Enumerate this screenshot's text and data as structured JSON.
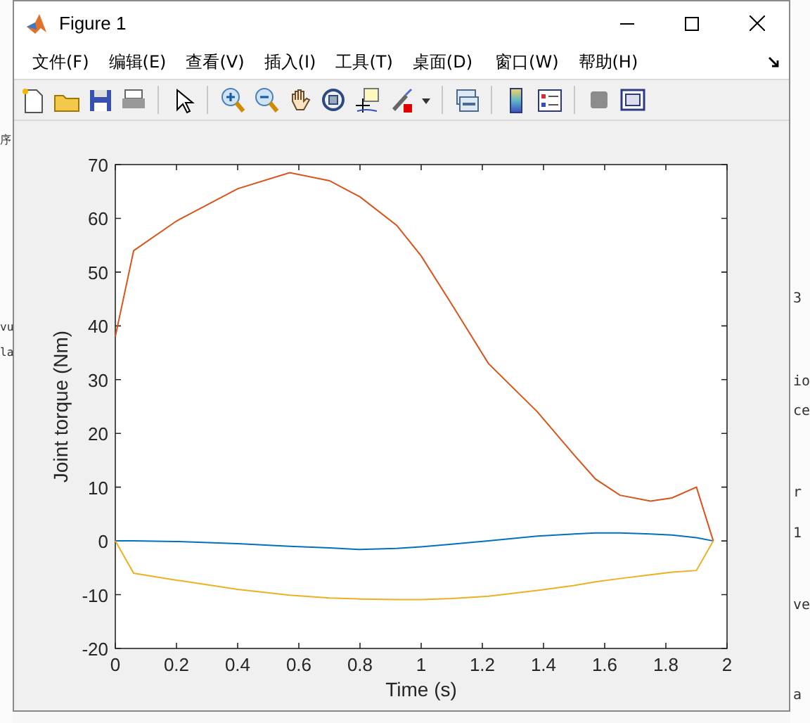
{
  "background": {
    "left_fragments": [
      "序",
      "vu",
      "la"
    ],
    "right_fragments": [
      "3",
      "io",
      "ce",
      "r",
      "1",
      "ve",
      "a"
    ]
  },
  "window": {
    "title": "Figure 1"
  },
  "menu": [
    "文件(F)",
    "编辑(E)",
    "查看(V)",
    "插入(I)",
    "工具(T)",
    "桌面(D)",
    "窗口(W)",
    "帮助(H)"
  ],
  "figure": {
    "chart_data": {
      "type": "line",
      "xlabel": "Time (s)",
      "ylabel": "Joint torque (Nm)",
      "xlim": [
        0,
        2
      ],
      "ylim": [
        -20,
        70
      ],
      "xticks": [
        0,
        0.2,
        0.4,
        0.6,
        0.8,
        1,
        1.2,
        1.4,
        1.6,
        1.8,
        2
      ],
      "yticks": [
        -20,
        -10,
        0,
        10,
        20,
        30,
        40,
        50,
        60,
        70
      ],
      "x": [
        0,
        0.06,
        0.2,
        0.4,
        0.57,
        0.7,
        0.8,
        0.92,
        1.0,
        1.1,
        1.22,
        1.38,
        1.5,
        1.57,
        1.65,
        1.75,
        1.82,
        1.9,
        1.955
      ],
      "series": [
        {
          "color": "#0072bd",
          "values": [
            0,
            0,
            -0.1,
            -0.5,
            -1,
            -1.3,
            -1.6,
            -1.4,
            -1.1,
            -0.6,
            0,
            0.9,
            1.3,
            1.5,
            1.5,
            1.3,
            1.1,
            0.6,
            0
          ]
        },
        {
          "color": "#d95319",
          "values": [
            38,
            54,
            59.5,
            65.5,
            68.5,
            67,
            64,
            58.7,
            53,
            44,
            33,
            24,
            16,
            11.5,
            8.5,
            7.4,
            8,
            10,
            0
          ]
        },
        {
          "color": "#edb120",
          "values": [
            0,
            -6,
            -7.3,
            -9,
            -10.1,
            -10.6,
            -10.8,
            -10.9,
            -10.9,
            -10.7,
            -10.3,
            -9.2,
            -8.3,
            -7.6,
            -7,
            -6.3,
            -5.8,
            -5.5,
            0
          ]
        }
      ]
    }
  }
}
